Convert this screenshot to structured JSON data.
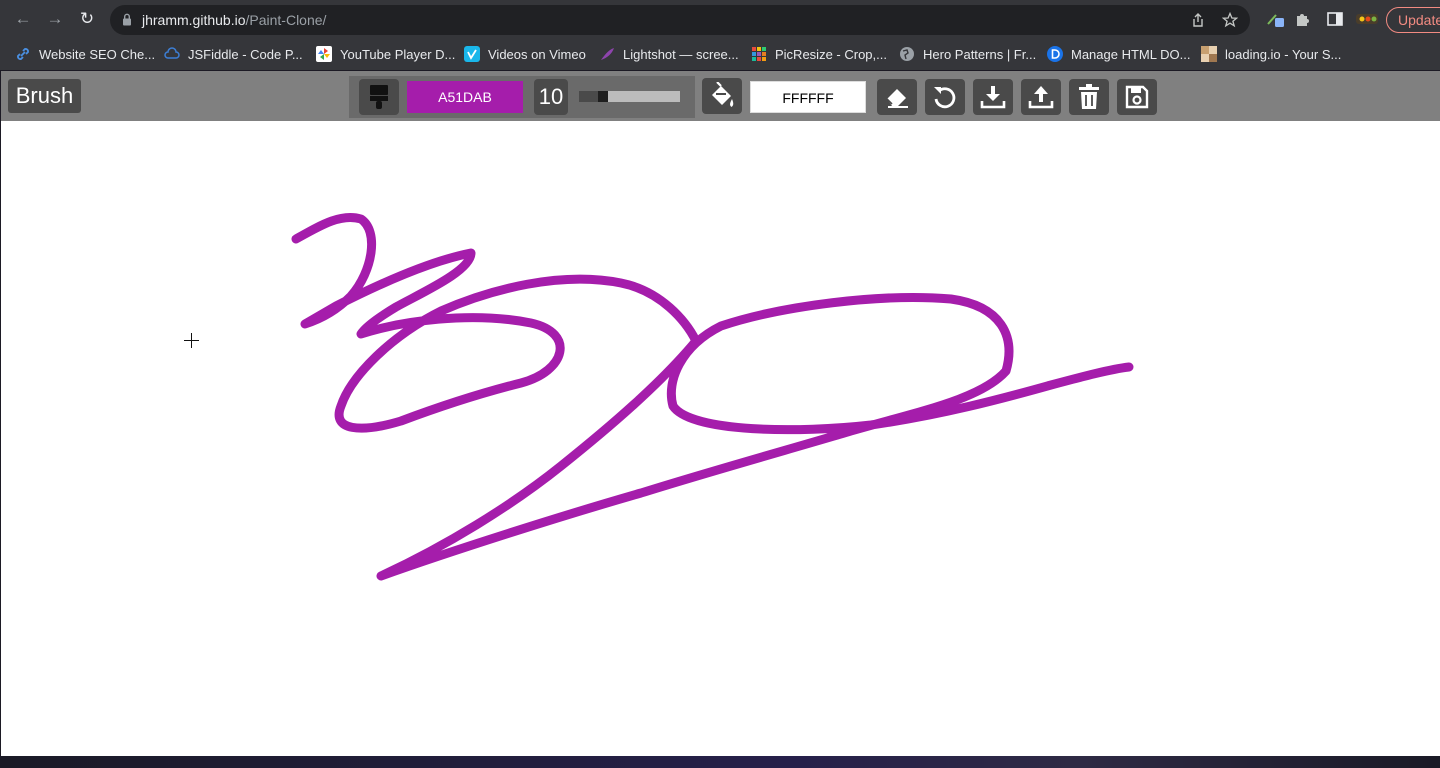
{
  "browser": {
    "url_host": "jhramm.github.io",
    "url_path": "/Paint-Clone/",
    "update_label": "Update",
    "bookmarks": [
      {
        "label": "Website SEO Che...",
        "icon": "link-icon",
        "color": "#4a90e2"
      },
      {
        "label": "JSFiddle - Code P...",
        "icon": "cloud-icon",
        "color": "#3d7fd6"
      },
      {
        "label": "YouTube Player D...",
        "icon": "pinwheel-icon",
        "color": "#ffffff"
      },
      {
        "label": "Videos on Vimeo",
        "icon": "vimeo-icon",
        "color": "#1ab7ea"
      },
      {
        "label": "Lightshot — scree...",
        "icon": "feather-icon",
        "color": "#8e44ad"
      },
      {
        "label": "PicResize - Crop,...",
        "icon": "grid-icon",
        "color": "#e67e22"
      },
      {
        "label": "Hero Patterns | Fr...",
        "icon": "globe-icon",
        "color": "#9aa0a6"
      },
      {
        "label": "Manage HTML DO...",
        "icon": "d-circle-icon",
        "color": "#1a73e8"
      },
      {
        "label": "loading.io - Your S...",
        "icon": "puzzle-img-icon",
        "color": "#c8a070"
      }
    ]
  },
  "app": {
    "active_tool": "Brush",
    "brush_color": "A51DAB",
    "brush_color_hex": "#A51DAB",
    "brush_size": "10",
    "brush_size_fraction": 0.21,
    "background_color": "FFFFFF",
    "background_color_hex": "#FFFFFF",
    "toolbar_icons": [
      "brush-icon",
      "fill-bucket-icon",
      "eraser-icon",
      "undo-icon",
      "download-icon",
      "upload-icon",
      "trash-icon",
      "save-icon"
    ],
    "stroke_color": "#A51DAB"
  }
}
